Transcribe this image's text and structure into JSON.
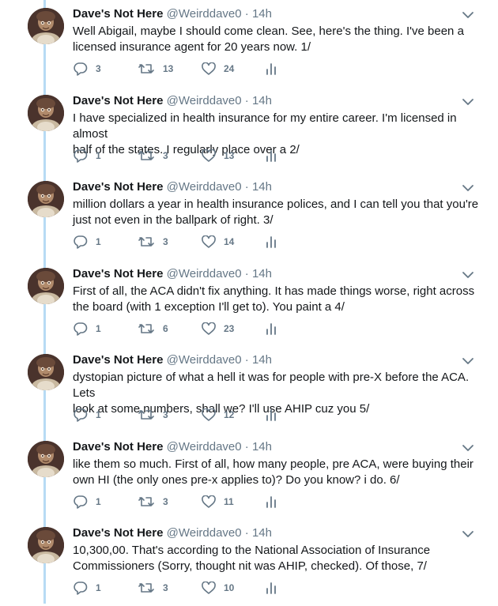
{
  "colors": {
    "name": "#14171a",
    "muted": "#657786",
    "thread_line": "#b7dbf4"
  },
  "icons": {
    "reply": "reply-icon",
    "retweet": "retweet-icon",
    "like": "heart-icon",
    "analytics": "analytics-icon",
    "caret": "chevron-down-icon"
  },
  "tweets": [
    {
      "name": "Dave's Not Here",
      "handle": "@Weirddave0",
      "sep": "·",
      "time": "14h",
      "line1": "Well Abigail, maybe I should come clean. See, here's the thing. I've been a",
      "line2": "licensed insurance agent for 20 years now. 1/",
      "replies": "3",
      "retweets": "13",
      "likes": "24"
    },
    {
      "name": "Dave's Not Here",
      "handle": "@Weirddave0",
      "sep": "·",
      "time": "14h",
      "line1": "I have specialized in health insurance for my entire career. I'm licensed in almost",
      "line2": "half of the states. I regularly place over a 2/",
      "replies": "1",
      "retweets": "3",
      "likes": "13"
    },
    {
      "name": "Dave's Not Here",
      "handle": "@Weirddave0",
      "sep": "·",
      "time": "14h",
      "line1": "million dollars a year in health insurance polices, and I can tell you that you're",
      "line2": "just not even in the ballpark of right. 3/",
      "replies": "1",
      "retweets": "3",
      "likes": "14"
    },
    {
      "name": "Dave's Not Here",
      "handle": "@Weirddave0",
      "sep": "·",
      "time": "14h",
      "line1": "First of all, the ACA didn't fix anything. It has made things worse, right across",
      "line2": "the board (with 1 exception I'll get to). You paint a 4/",
      "replies": "1",
      "retweets": "6",
      "likes": "23"
    },
    {
      "name": "Dave's Not Here",
      "handle": "@Weirddave0",
      "sep": "·",
      "time": "14h",
      "line1": "dystopian picture of what a hell it was for people with pre-X before the ACA. Lets",
      "line2": "look at some numbers, shall we? I'll use AHIP cuz you 5/",
      "replies": "1",
      "retweets": "3",
      "likes": "12"
    },
    {
      "name": "Dave's Not Here",
      "handle": "@Weirddave0",
      "sep": "·",
      "time": "14h",
      "line1": "like them so much. First of all, how many people, pre ACA, were buying their",
      "line2": "own HI (the only ones pre-x applies to)? Do you know? i do. 6/",
      "replies": "1",
      "retweets": "3",
      "likes": "11"
    },
    {
      "name": "Dave's Not Here",
      "handle": "@Weirddave0",
      "sep": "·",
      "time": "14h",
      "line1": "10,300,00. That's according to the National Association of Insurance",
      "line2": "Commissioners (Sorry, thought nit was AHIP, checked). Of those, 7/",
      "replies": "1",
      "retweets": "3",
      "likes": "10"
    }
  ]
}
